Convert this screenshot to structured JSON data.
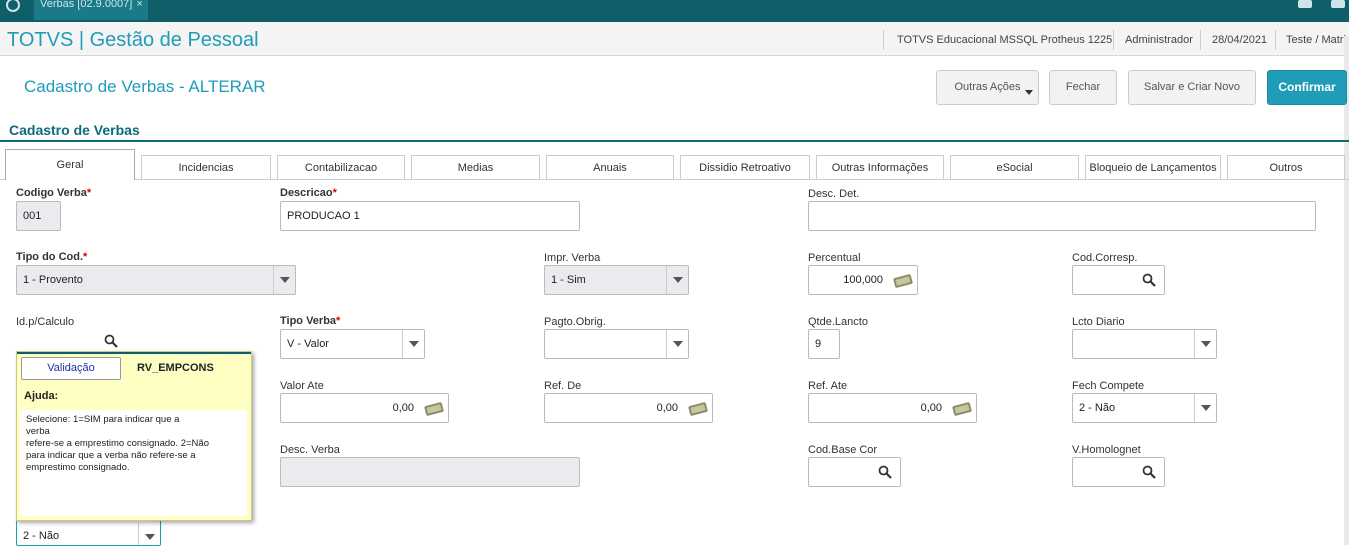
{
  "window": {
    "tab_title": "Verbas [02.9.0007]",
    "tab_close": "×"
  },
  "header": {
    "app_title": "TOTVS | Gestão de Pessoal",
    "environment": "TOTVS Educacional MSSQL Protheus 1225",
    "user": "Administrador",
    "date": "28/04/2021",
    "branch": "Teste / Matri"
  },
  "page": {
    "title": "Cadastro de Verbas - ALTERAR"
  },
  "actions": {
    "outras_acoes": "Outras Ações",
    "fechar": "Fechar",
    "salvar_novo": "Salvar e Criar Novo",
    "confirmar": "Confirmar"
  },
  "section": {
    "title": "Cadastro de Verbas"
  },
  "tabs": [
    {
      "label": "Geral"
    },
    {
      "label": "Incidencias"
    },
    {
      "label": "Contabilizacao"
    },
    {
      "label": "Medias"
    },
    {
      "label": "Anuais"
    },
    {
      "label": "Dissidio Retroativo"
    },
    {
      "label": "Outras Informações"
    },
    {
      "label": "eSocial"
    },
    {
      "label": "Bloqueio de Lançamentos"
    },
    {
      "label": "Outros"
    }
  ],
  "fields": {
    "codigo_verba": {
      "label": "Codigo Verba",
      "value": "001"
    },
    "descricao": {
      "label": "Descricao",
      "value": "PRODUCAO 1"
    },
    "desc_det": {
      "label": "Desc. Det.",
      "value": ""
    },
    "tipo_cod": {
      "label": "Tipo do Cod.",
      "value": "1 - Provento"
    },
    "impr_verba": {
      "label": "Impr. Verba",
      "value": "1 - Sim"
    },
    "percentual": {
      "label": "Percentual",
      "value": "100,000"
    },
    "cod_corresp": {
      "label": "Cod.Corresp.",
      "value": ""
    },
    "id_calculo": {
      "label": "Id.p/Calculo",
      "value": ""
    },
    "tipo_verba": {
      "label": "Tipo Verba",
      "value": "V - Valor"
    },
    "pagto_obrig": {
      "label": "Pagto.Obrig.",
      "value": ""
    },
    "qtde_lancto": {
      "label": "Qtde.Lancto",
      "value": "9"
    },
    "lcto_diario": {
      "label": "Lcto Diario",
      "value": ""
    },
    "valor_ate": {
      "label": "Valor Ate",
      "value": "0,00"
    },
    "ref_de": {
      "label": "Ref. De",
      "value": "0,00"
    },
    "ref_ate": {
      "label": "Ref. Ate",
      "value": "0,00"
    },
    "fech_compete": {
      "label": "Fech Compete",
      "value": "2 - Não"
    },
    "desc_verba": {
      "label": "Desc. Verba",
      "value": ""
    },
    "cod_base_cor": {
      "label": "Cod.Base Cor",
      "value": ""
    },
    "v_homolognet": {
      "label": "V.Homolognet",
      "value": ""
    },
    "emp_cons": {
      "label": "",
      "value": "2 - Não"
    }
  },
  "tooltip": {
    "validacao": "Validação",
    "code": "RV_EMPCONS",
    "help_title": "Ajuda:",
    "help_line1": "Selecione: 1=SIM para indicar que a",
    "help_line2": "verba",
    "help_line3": "refere-se a emprestimo consignado. 2=Não",
    "help_line4": "para indicar que a verba não refere-se a",
    "help_line5": "emprestimo consignado."
  },
  "colors": {
    "accent": "#1f9cb8",
    "topbar": "#0f5f6b",
    "section": "#0f6a7c",
    "tooltip_bg": "#ffffc4"
  },
  "icons": [
    "search-icon",
    "calculator-icon",
    "chevron-down-icon",
    "close-icon"
  ]
}
